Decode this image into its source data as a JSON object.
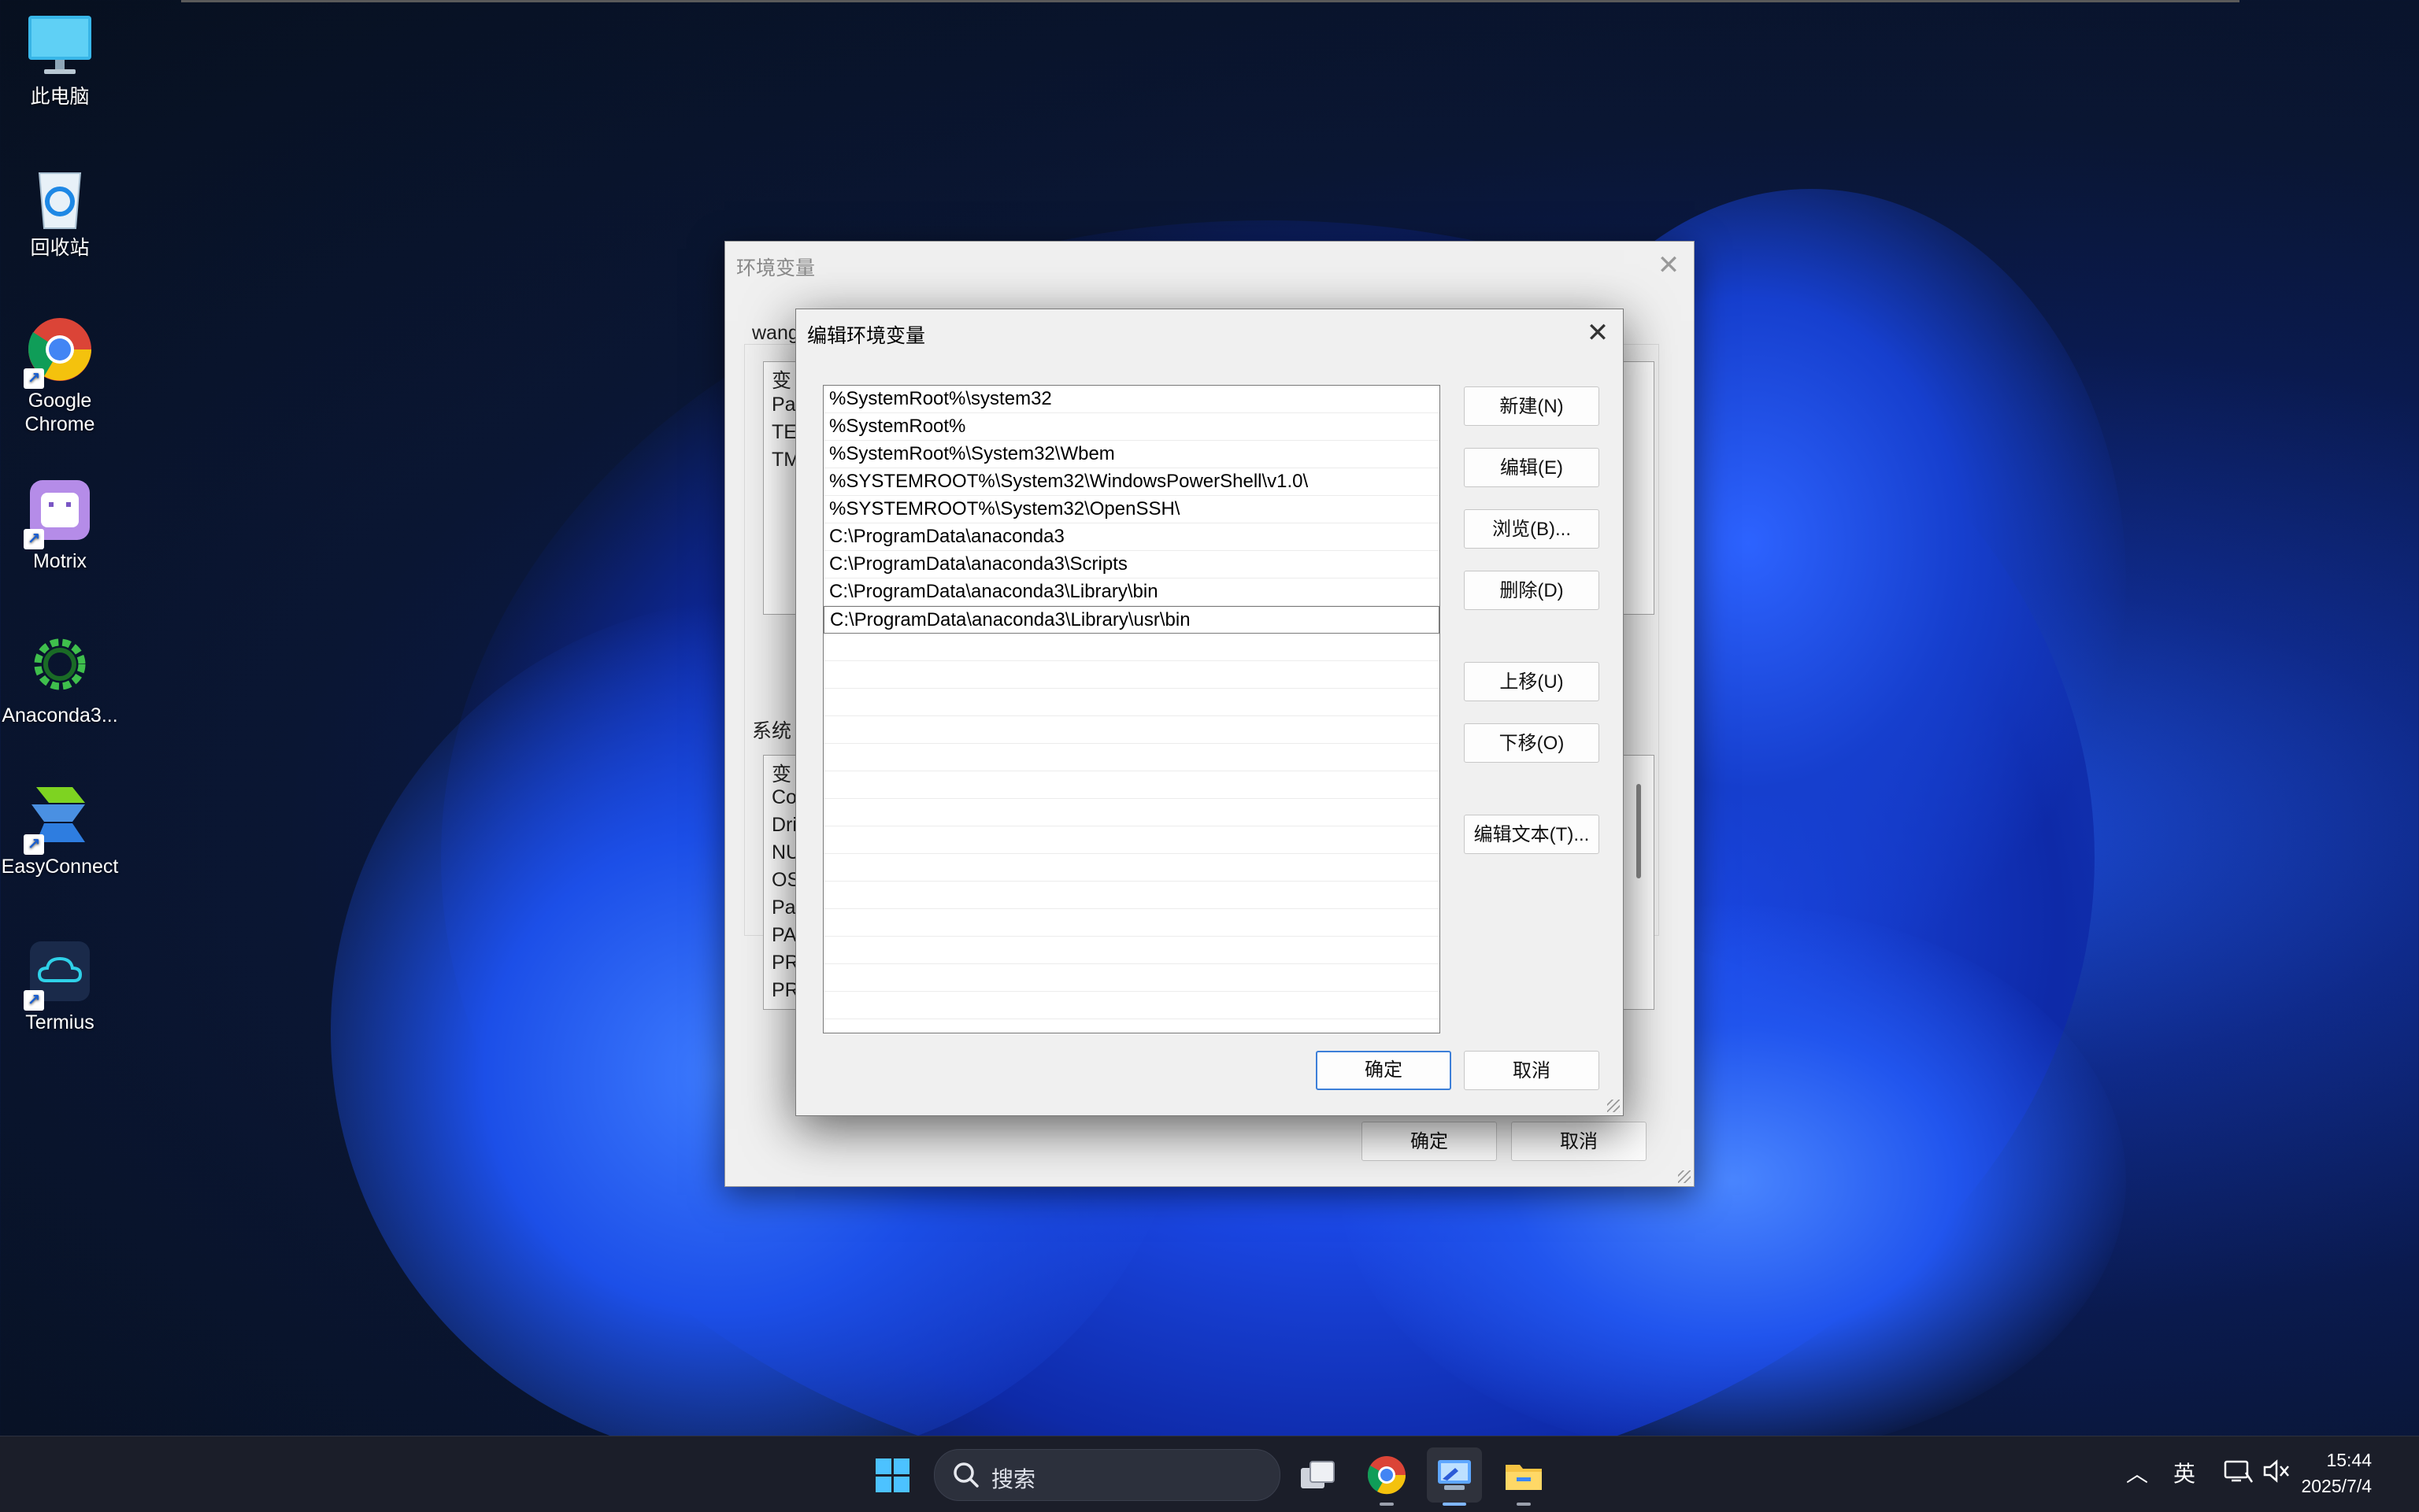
{
  "desktop_icons": [
    {
      "label": "此电脑",
      "icon": "computer-icon"
    },
    {
      "label": "回收站",
      "icon": "recycle-bin-icon"
    },
    {
      "label": "Google Chrome",
      "icon": "chrome-icon"
    },
    {
      "label": "Motrix",
      "icon": "motrix-icon"
    },
    {
      "label": "Anaconda3...",
      "icon": "anaconda-icon"
    },
    {
      "label": "EasyConnect",
      "icon": "easyconnect-icon"
    },
    {
      "label": "Termius",
      "icon": "termius-icon"
    }
  ],
  "bg_window": {
    "title": "环境变量",
    "user_section_label": "wang",
    "user_rows": [
      "变",
      "Pat",
      "TEI",
      "TM"
    ],
    "system_section_label": "系统",
    "system_rows": [
      "变",
      "Co",
      "Dri",
      "NU",
      "OS",
      "Pat",
      "PA",
      "PR",
      "PR"
    ],
    "ok_label": "确定",
    "cancel_label": "取消"
  },
  "dialog": {
    "title": "编辑环境变量",
    "paths": [
      "%SystemRoot%\\system32",
      "%SystemRoot%",
      "%SystemRoot%\\System32\\Wbem",
      "%SYSTEMROOT%\\System32\\WindowsPowerShell\\v1.0\\",
      "%SYSTEMROOT%\\System32\\OpenSSH\\",
      "C:\\ProgramData\\anaconda3",
      "C:\\ProgramData\\anaconda3\\Scripts",
      "C:\\ProgramData\\anaconda3\\Library\\bin",
      "C:\\ProgramData\\anaconda3\\Library\\usr\\bin"
    ],
    "selected_index": 8,
    "buttons": {
      "new": "新建(N)",
      "edit": "编辑(E)",
      "browse": "浏览(B)...",
      "delete": "删除(D)",
      "move_up": "上移(U)",
      "move_down": "下移(O)",
      "edit_text": "编辑文本(T)..."
    },
    "ok_label": "确定",
    "cancel_label": "取消"
  },
  "taskbar": {
    "search_placeholder": "搜索",
    "ime_label": "英",
    "time": "15:44",
    "date": "2025/7/4"
  }
}
